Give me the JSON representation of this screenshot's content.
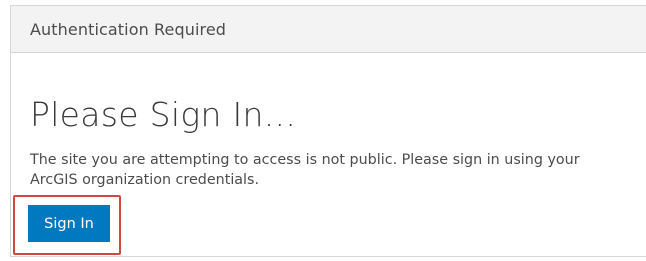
{
  "panel": {
    "header_title": "Authentication Required"
  },
  "main": {
    "heading": "Please Sign In...",
    "message": "The site you are attempting to access is not public. Please sign in using your ArcGIS organization credentials.",
    "sign_in_label": "Sign In"
  },
  "colors": {
    "button_background": "#0079c1",
    "highlight_border": "#d64541",
    "header_background": "#f3f3f3"
  }
}
